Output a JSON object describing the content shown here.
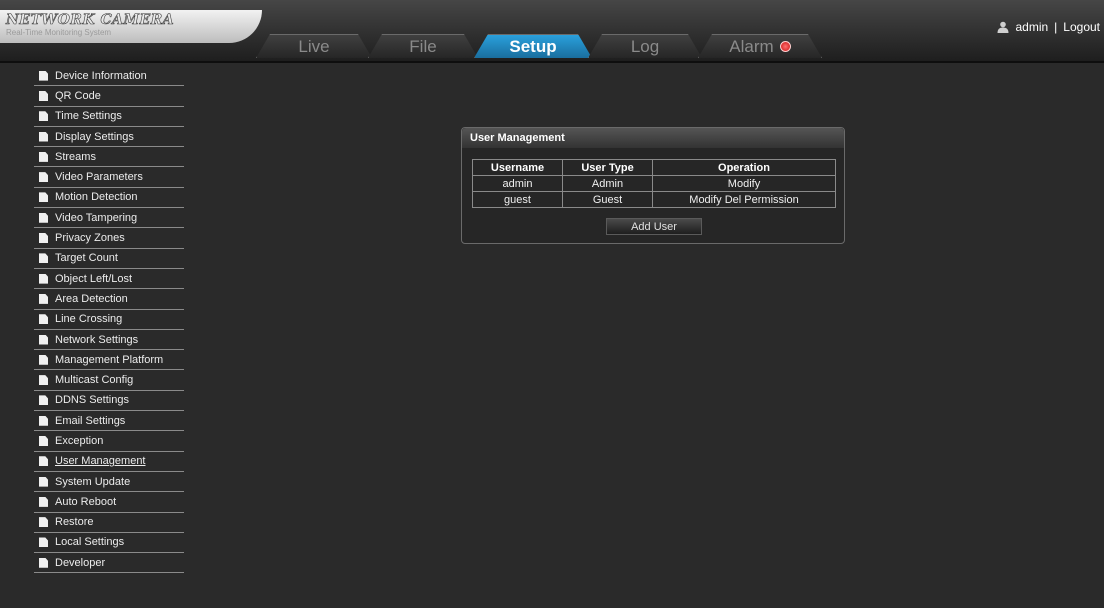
{
  "brand": {
    "title": "NETWORK CAMERA",
    "subtitle": "Real-Time Monitoring System"
  },
  "tabs": [
    {
      "label": "Live",
      "active": false
    },
    {
      "label": "File",
      "active": false
    },
    {
      "label": "Setup",
      "active": true
    },
    {
      "label": "Log",
      "active": false
    },
    {
      "label": "Alarm",
      "active": false
    }
  ],
  "header": {
    "user": "admin",
    "separator": "|",
    "logout": "Logout"
  },
  "sidebar": {
    "active_item": "User Management",
    "items": [
      "Device Information",
      "QR Code",
      "Time Settings",
      "Display Settings",
      "Streams",
      "Video Parameters",
      "Motion Detection",
      "Video Tampering",
      "Privacy Zones",
      "Target Count",
      "Object Left/Lost",
      "Area Detection",
      "Line Crossing",
      "Network Settings",
      "Management Platform",
      "Multicast Config",
      "DDNS Settings",
      "Email Settings",
      "Exception",
      "User Management",
      "System Update",
      "Auto Reboot",
      "Restore",
      "Local Settings",
      "Developer"
    ]
  },
  "user_management": {
    "title": "User Management",
    "columns": [
      "Username",
      "User Type",
      "Operation"
    ],
    "rows": [
      [
        "admin",
        "Admin",
        "Modify"
      ],
      [
        "guest",
        "Guest",
        "Modify Del Permission"
      ]
    ],
    "add_button": "Add User"
  },
  "colors": {
    "background": "#2a2a2a",
    "active_tab": "#1f86c0",
    "alarm": "#d02020"
  },
  "icons": {
    "sidebar_item": "document-icon",
    "user": "user-icon",
    "alarm": "alarm-indicator-icon"
  }
}
